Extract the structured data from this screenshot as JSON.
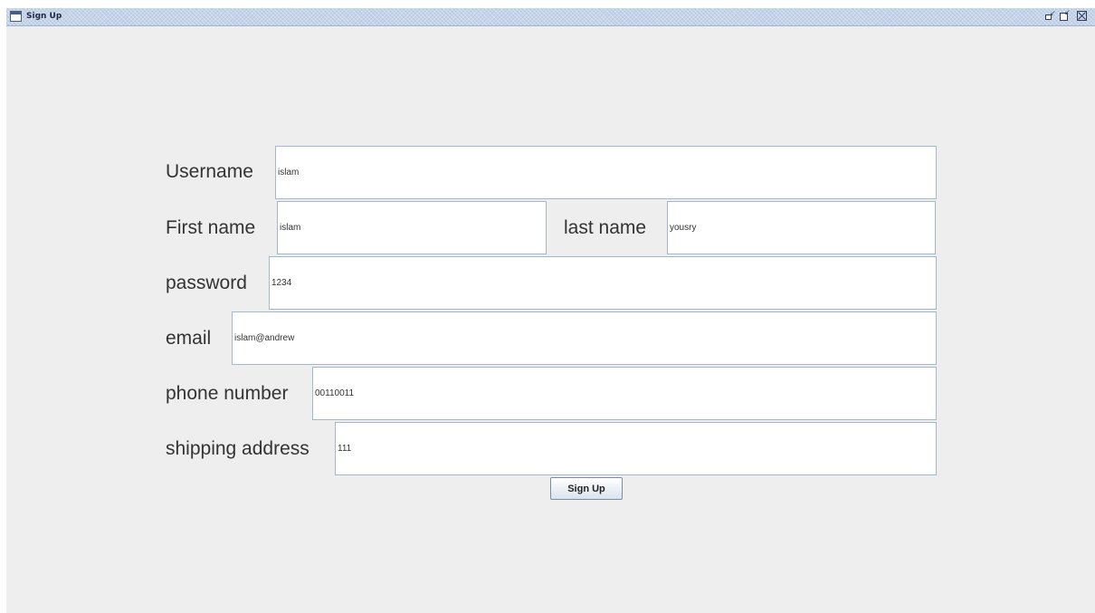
{
  "window": {
    "title": "Sign Up",
    "controls": {
      "minimize": "minimize-icon",
      "maximize": "maximize-icon",
      "close": "close-icon"
    }
  },
  "form": {
    "username_label": "Username",
    "username_value": "islam",
    "first_name_label": "First name",
    "first_name_value": "islam",
    "last_name_label": "last name",
    "last_name_value": "yousry",
    "password_label": "password",
    "password_value": "1234",
    "email_label": "email",
    "email_value": "islam@andrew",
    "phone_label": "phone number",
    "phone_value": "00110011",
    "address_label": "shipping address",
    "address_value": "111",
    "submit_label": "Sign Up"
  },
  "colors": {
    "window_bg": "#eeeeee",
    "titlebar": "#c4d3e8",
    "field_border": "#a3b8cc",
    "label_text": "#333333"
  }
}
